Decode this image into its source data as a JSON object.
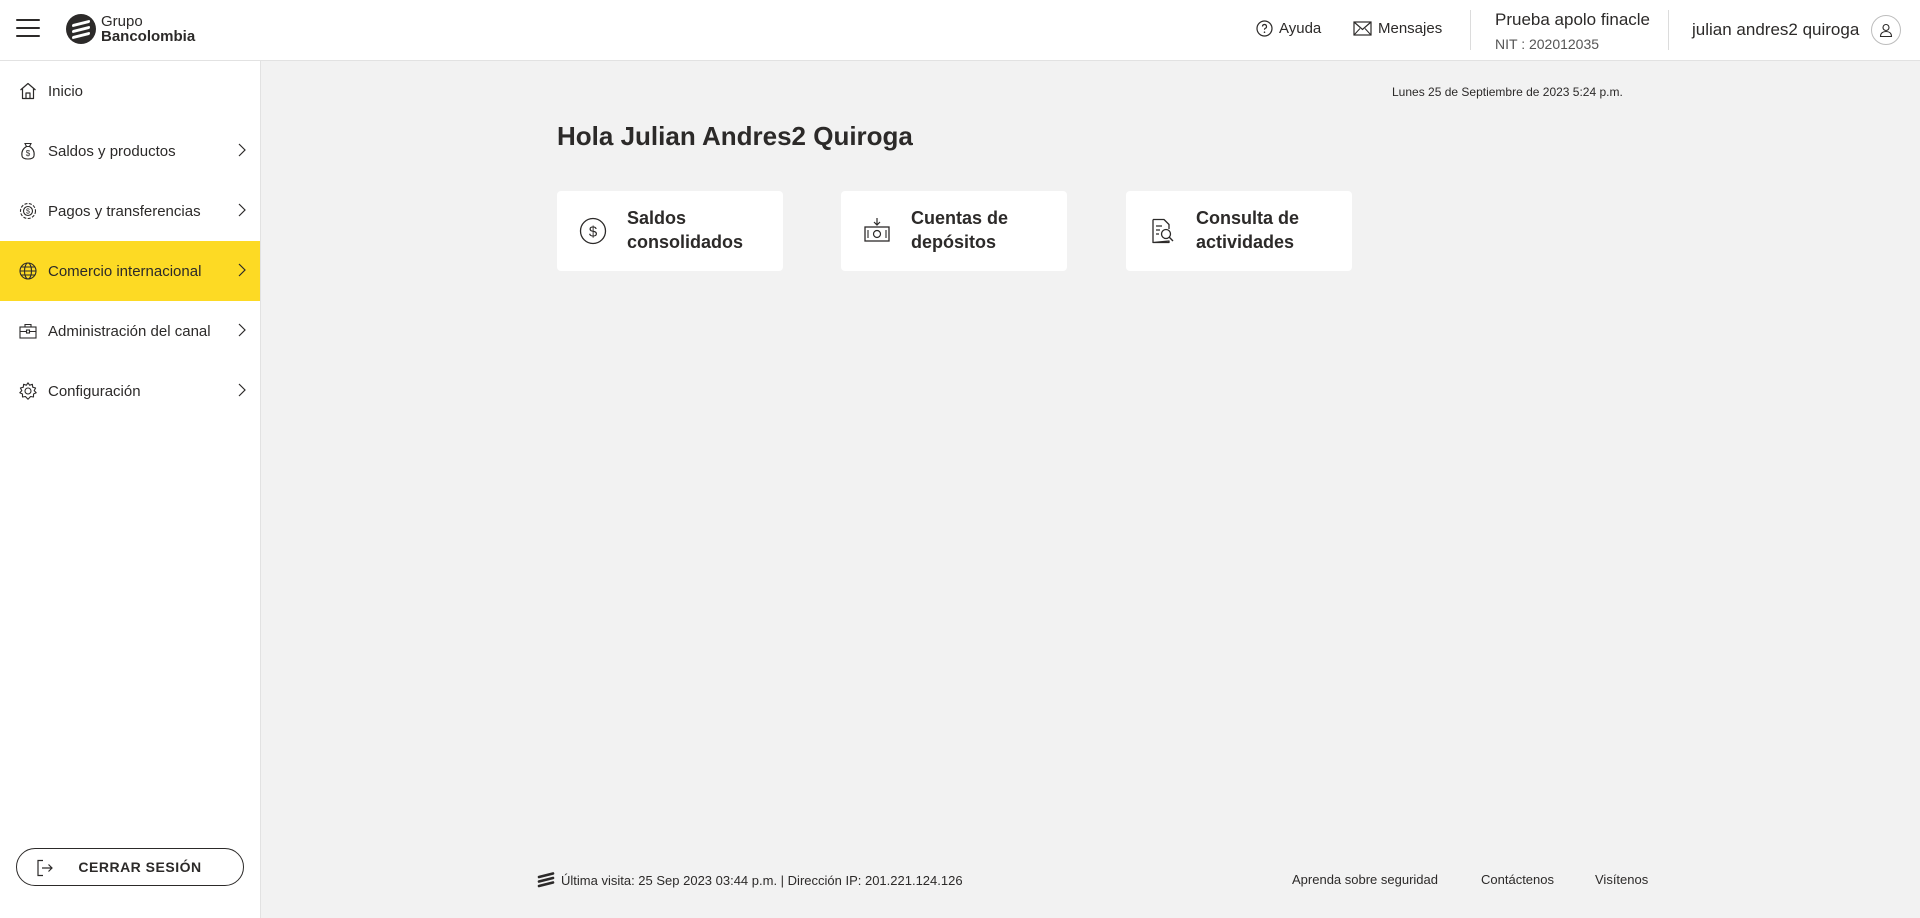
{
  "header": {
    "logo": {
      "line1": "Grupo",
      "line2": "Bancolombia"
    },
    "help_label": "Ayuda",
    "messages_label": "Mensajes",
    "company_name": "Prueba apolo finacle",
    "company_nit": "NIT : 202012035",
    "user_name": "julian andres2 quiroga"
  },
  "sidebar": {
    "items": [
      {
        "label": "Inicio",
        "icon": "home-icon",
        "has_submenu": false,
        "active": false
      },
      {
        "label": "Saldos y productos",
        "icon": "money-bag-icon",
        "has_submenu": true,
        "active": false
      },
      {
        "label": "Pagos y transferencias",
        "icon": "payment-gear-icon",
        "has_submenu": true,
        "active": false
      },
      {
        "label": "Comercio internacional",
        "icon": "globe-icon",
        "has_submenu": true,
        "active": true
      },
      {
        "label": "Administración del canal",
        "icon": "briefcase-icon",
        "has_submenu": true,
        "active": false
      },
      {
        "label": "Configuración",
        "icon": "gear-icon",
        "has_submenu": true,
        "active": false
      }
    ],
    "logout_label": "CERRAR SESIÓN"
  },
  "main": {
    "datetime": "Lunes 25 de Septiembre de 2023 5:24 p.m.",
    "greeting": "Hola Julian Andres2 Quiroga",
    "cards": [
      {
        "line1": "Saldos",
        "line2": "consolidados",
        "icon": "dollar-circle-icon"
      },
      {
        "line1": "Cuentas de",
        "line2": "depósitos",
        "icon": "cash-deposit-icon"
      },
      {
        "line1": "Consulta de",
        "line2": "actividades",
        "icon": "document-search-icon"
      }
    ]
  },
  "footer": {
    "last_visit": "Última visita: 25 Sep 2023 03:44 p.m. | Dirección IP: 201.221.124.126",
    "links": [
      "Aprenda sobre seguridad",
      "Contáctenos",
      "Visítenos"
    ]
  },
  "colors": {
    "accent": "#fdda24",
    "text": "#2c2a29",
    "background": "#f2f2f2"
  }
}
